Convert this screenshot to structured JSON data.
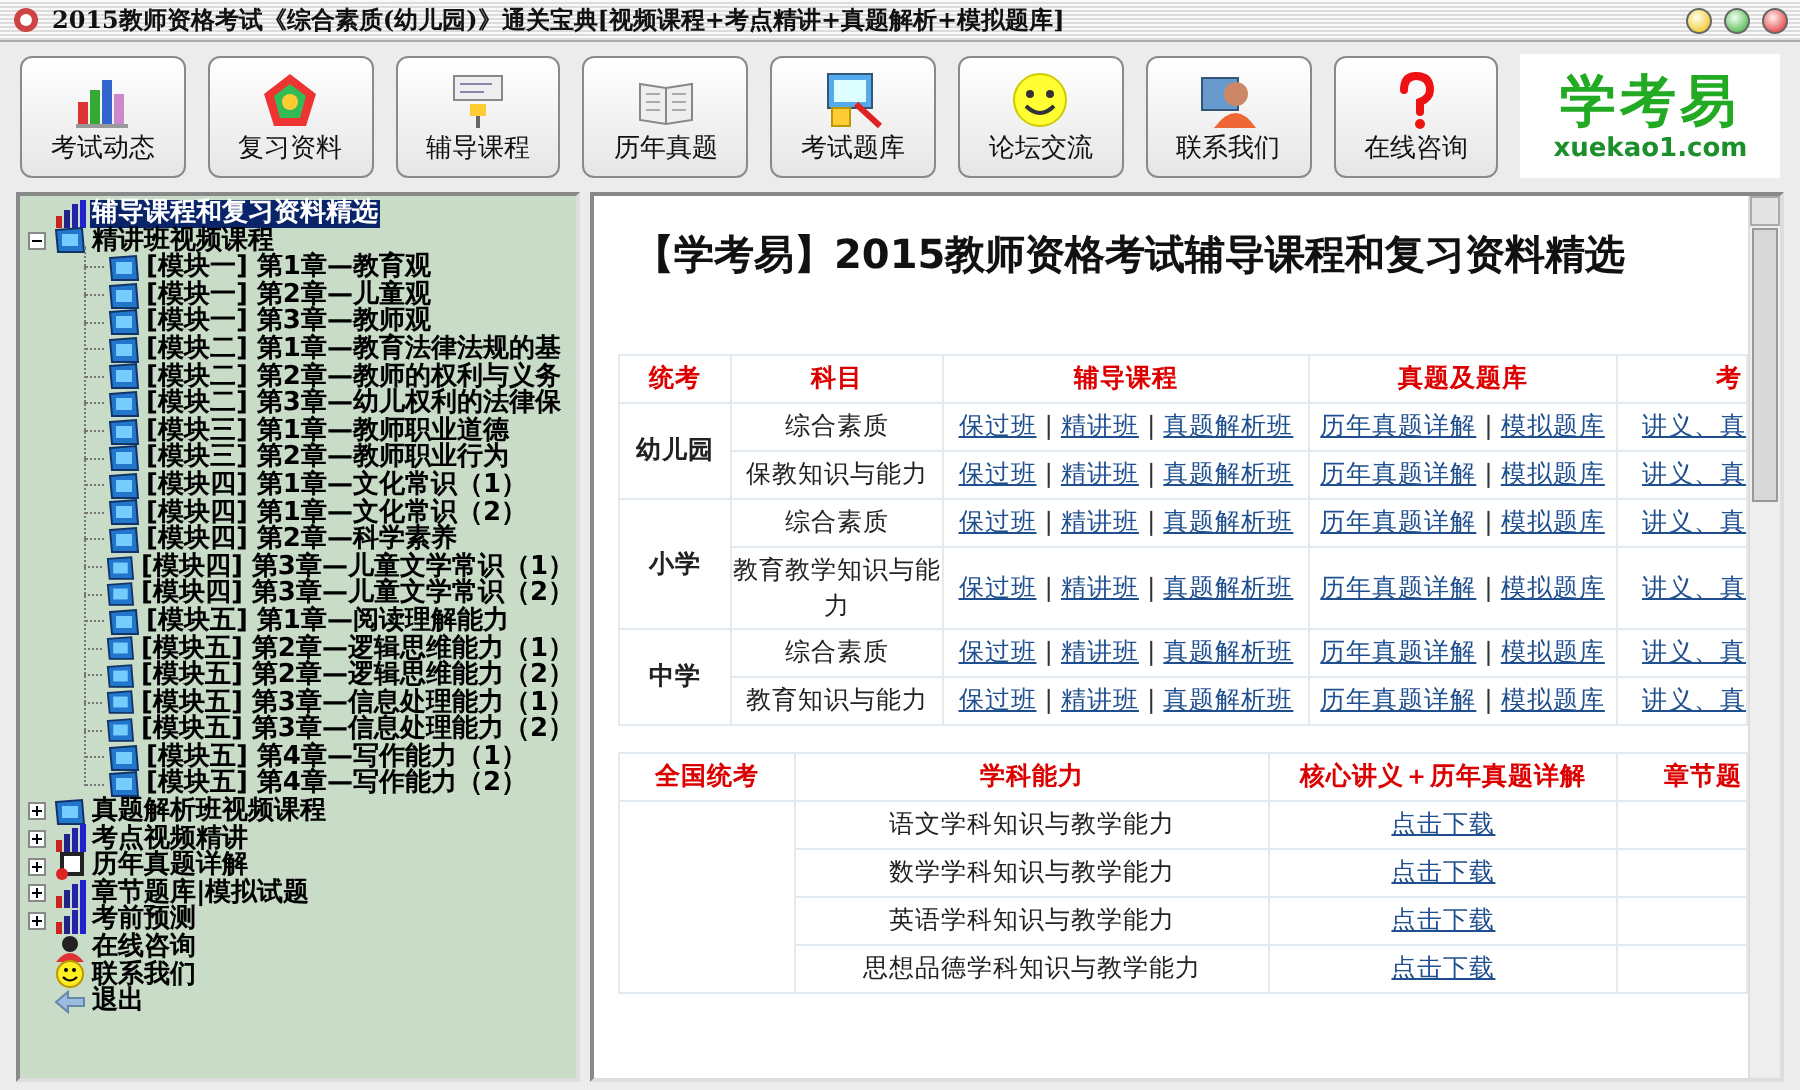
{
  "window": {
    "title": "2015教师资格考试《综合素质(幼儿园)》通关宝典[视频课程+考点精讲+真题解析+模拟题库]"
  },
  "toolbar": [
    {
      "label": "考试动态",
      "kind": "chart"
    },
    {
      "label": "复习资料",
      "kind": "pentagon"
    },
    {
      "label": "辅导课程",
      "kind": "easel"
    },
    {
      "label": "历年真题",
      "kind": "book"
    },
    {
      "label": "考试题库",
      "kind": "monitor"
    },
    {
      "label": "论坛交流",
      "kind": "smiley"
    },
    {
      "label": "联系我们",
      "kind": "person"
    },
    {
      "label": "在线咨询",
      "kind": "question"
    }
  ],
  "logo": {
    "name": "学考易",
    "site": "xuekao1.com"
  },
  "tree": [
    {
      "label": "辅导课程和复习资料精选",
      "kind": "chart",
      "selected": true
    },
    {
      "label": "精讲班视频课程",
      "kind": "video",
      "selected": false,
      "expanded": true,
      "children": [
        {
          "label": "[模块一] 第1章—教育观",
          "kind": "video",
          "selected": false
        },
        {
          "label": "[模块一] 第2章—儿童观",
          "kind": "video",
          "selected": false
        },
        {
          "label": "[模块一] 第3章—教师观",
          "kind": "video",
          "selected": false
        },
        {
          "label": "[模块二] 第1章—教育法律法规的基",
          "kind": "video",
          "selected": false
        },
        {
          "label": "[模块二] 第2章—教师的权利与义务",
          "kind": "video",
          "selected": false
        },
        {
          "label": "[模块二] 第3章—幼儿权利的法律保",
          "kind": "video",
          "selected": false
        },
        {
          "label": "[模块三] 第1章—教师职业道德",
          "kind": "video",
          "selected": false
        },
        {
          "label": "[模块三] 第2章—教师职业行为",
          "kind": "video",
          "selected": false
        },
        {
          "label": "[模块四] 第1章—文化常识（1）",
          "kind": "video",
          "selected": false
        },
        {
          "label": "[模块四] 第1章—文化常识（2）",
          "kind": "video",
          "selected": false
        },
        {
          "label": "[模块四] 第2章—科学素养",
          "kind": "video",
          "selected": false
        },
        {
          "label": "[模块四] 第3章—儿童文学常识（1）",
          "kind": "video",
          "selected": false
        },
        {
          "label": "[模块四] 第3章—儿童文学常识（2）",
          "kind": "video",
          "selected": false
        },
        {
          "label": "[模块五] 第1章—阅读理解能力",
          "kind": "video",
          "selected": false
        },
        {
          "label": "[模块五] 第2章—逻辑思维能力（1）",
          "kind": "video",
          "selected": false
        },
        {
          "label": "[模块五] 第2章—逻辑思维能力（2）",
          "kind": "video",
          "selected": false
        },
        {
          "label": "[模块五] 第3章—信息处理能力（1）",
          "kind": "video",
          "selected": false
        },
        {
          "label": "[模块五] 第3章—信息处理能力（2）",
          "kind": "video",
          "selected": false
        },
        {
          "label": "[模块五] 第4章—写作能力（1）",
          "kind": "video",
          "selected": false
        },
        {
          "label": "[模块五] 第4章—写作能力（2）",
          "kind": "video",
          "selected": false
        }
      ]
    },
    {
      "label": "真题解析班视频课程",
      "kind": "video",
      "selected": false,
      "expanded": false
    },
    {
      "label": "考点视频精讲",
      "kind": "chart",
      "selected": false,
      "expanded": false
    },
    {
      "label": "历年真题详解",
      "kind": "book",
      "selected": false,
      "expanded": false
    },
    {
      "label": "章节题库|模拟试题",
      "kind": "chart",
      "selected": false,
      "expanded": false
    },
    {
      "label": "考前预测",
      "kind": "chart",
      "selected": false,
      "expanded": false
    },
    {
      "label": "在线咨询",
      "kind": "person",
      "selected": false
    },
    {
      "label": "联系我们",
      "kind": "smiley",
      "selected": false
    },
    {
      "label": "退出",
      "kind": "exit",
      "selected": false
    }
  ],
  "content": {
    "heading": "【学考易】2015教师资格考试辅导课程和复习资料精选",
    "table1": {
      "columns": [
        "统考",
        "科目",
        "辅导课程",
        "真题及题库",
        "考"
      ],
      "groups": [
        {
          "name": "幼儿园",
          "rows": [
            {
              "subject": "综合素质",
              "courses": [
                "保过班",
                "|",
                "精讲班",
                "|",
                "真题解析班"
              ],
              "bank": [
                "历年真题详解",
                "|",
                "模拟题库"
              ],
              "column_5": "讲义、真"
            },
            {
              "subject": "保教知识与能力",
              "courses": [
                "保过班",
                "|",
                "精讲班",
                "|",
                "真题解析班"
              ],
              "bank": [
                "历年真题详解",
                "|",
                "模拟题库"
              ],
              "column_5": "讲义、真"
            }
          ]
        },
        {
          "name": "小学",
          "rows": [
            {
              "subject": "综合素质",
              "courses": [
                "保过班",
                "|",
                "精讲班",
                "|",
                "真题解析班"
              ],
              "bank": [
                "历年真题详解",
                "|",
                "模拟题库"
              ],
              "column_5": "讲义、真"
            },
            {
              "subject": "教育教学知识与能力",
              "courses": [
                "保过班",
                "|",
                "精讲班",
                "|",
                "真题解析班"
              ],
              "bank": [
                "历年真题详解",
                "|",
                "模拟题库"
              ],
              "column_5": "讲义、真"
            }
          ]
        },
        {
          "name": "中学",
          "rows": [
            {
              "subject": "综合素质",
              "courses": [
                "保过班",
                "|",
                "精讲班",
                "|",
                "真题解析班"
              ],
              "bank": [
                "历年真题详解",
                "|",
                "模拟题库"
              ],
              "column_5": "讲义、真"
            },
            {
              "subject": "教育知识与能力",
              "courses": [
                "保过班",
                "|",
                "精讲班",
                "|",
                "真题解析班"
              ],
              "bank": [
                "历年真题详解",
                "|",
                "模拟题库"
              ],
              "column_5": "讲义、真"
            }
          ]
        }
      ]
    },
    "table2": {
      "columns": [
        "全国统考",
        "学科能力",
        "核心讲义＋历年真题详解",
        "章节题"
      ],
      "rows": [
        {
          "subject": "语文学科知识与教学能力",
          "download": "点击下载"
        },
        {
          "subject": "数学学科知识与教学能力",
          "download": "点击下载"
        },
        {
          "subject": "英语学科知识与教学能力",
          "download": "点击下载"
        },
        {
          "subject": "思想品德学科知识与教学能力",
          "download": "点击下载"
        }
      ]
    }
  }
}
